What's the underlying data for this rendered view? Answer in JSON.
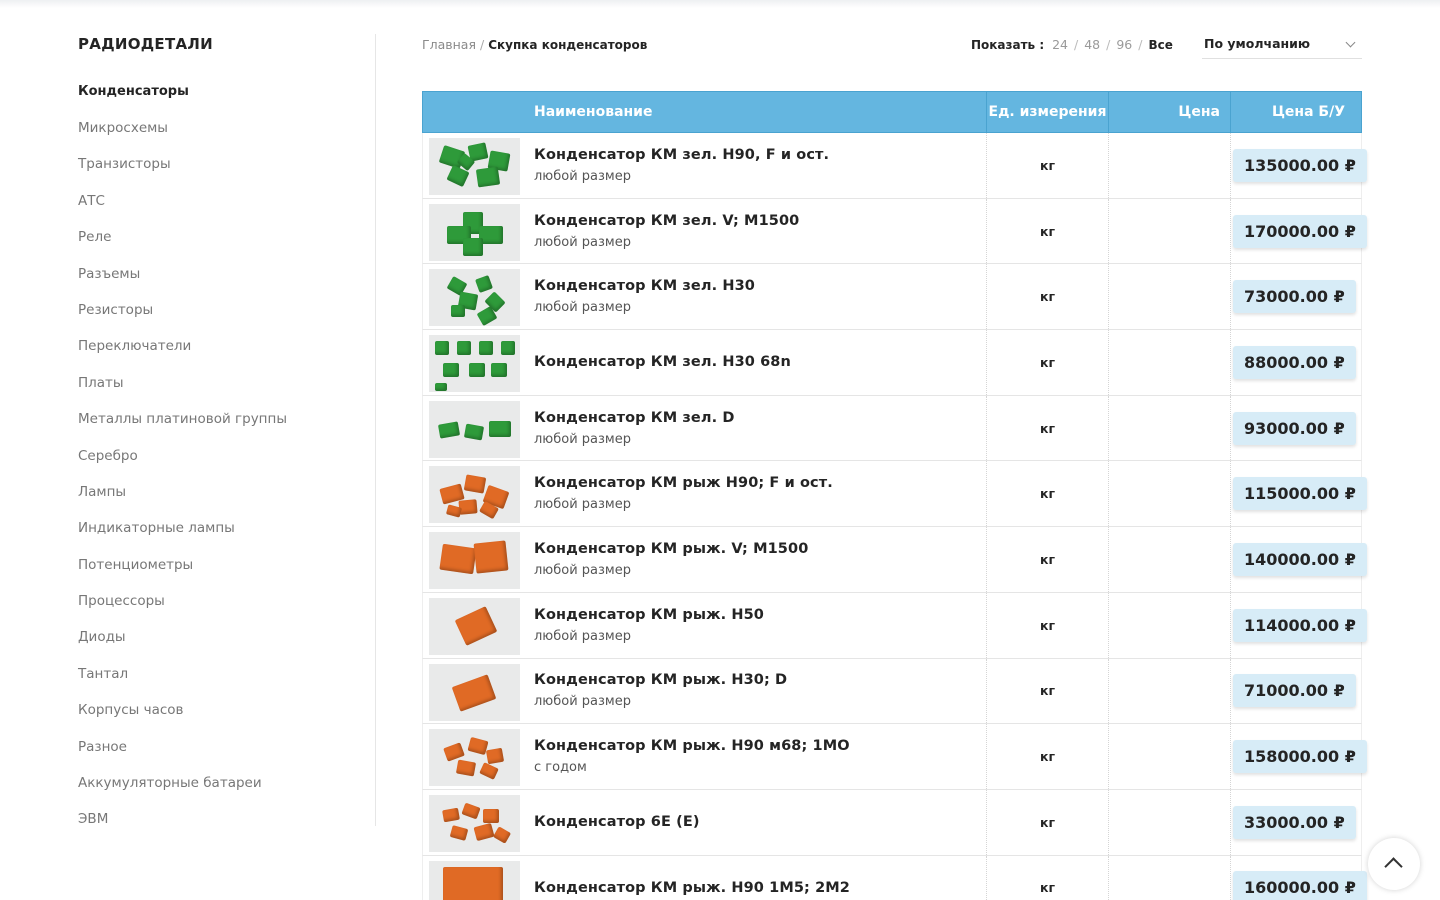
{
  "sidebar": {
    "title": "РАДИОДЕТАЛИ",
    "items": [
      {
        "label": "Конденсаторы",
        "active": true
      },
      {
        "label": "Микросхемы"
      },
      {
        "label": "Транзисторы"
      },
      {
        "label": "АТС"
      },
      {
        "label": "Реле"
      },
      {
        "label": "Разъемы"
      },
      {
        "label": "Резисторы"
      },
      {
        "label": "Переключатели"
      },
      {
        "label": "Платы"
      },
      {
        "label": "Металлы платиновой группы"
      },
      {
        "label": "Серебро"
      },
      {
        "label": "Лампы"
      },
      {
        "label": "Индикаторные лампы"
      },
      {
        "label": "Потенциометры"
      },
      {
        "label": "Процессоры"
      },
      {
        "label": "Диоды"
      },
      {
        "label": "Тантал"
      },
      {
        "label": "Корпусы часов"
      },
      {
        "label": "Разное"
      },
      {
        "label": "Аккумуляторные батареи"
      },
      {
        "label": "ЭВМ"
      }
    ]
  },
  "breadcrumb": {
    "home": "Главная",
    "separator": "/",
    "current": "Скупка конденсаторов"
  },
  "per_page": {
    "label": "Показать :",
    "options": [
      "24",
      "48",
      "96",
      "Все"
    ],
    "active": "Все",
    "separator": "/"
  },
  "sort": {
    "value": "По умолчанию"
  },
  "table": {
    "headers": {
      "name": "Наименование",
      "unit": "Ед. измерения",
      "price": "Цена",
      "used_price": "Цена Б/У"
    },
    "rows": [
      {
        "name": "Конденсатор КМ зел. Н90, F и ост.",
        "size": "любой размер",
        "unit": "кг",
        "price": "",
        "used_price": "135000.00 ₽",
        "thumb": "green"
      },
      {
        "name": "Конденсатор КМ зел. V; М1500",
        "size": "любой размер",
        "unit": "кг",
        "price": "",
        "used_price": "170000.00 ₽",
        "thumb": "green"
      },
      {
        "name": "Конденсатор КМ зел. Н30",
        "size": "любой размер",
        "unit": "кг",
        "price": "",
        "used_price": "73000.00 ₽",
        "thumb": "green"
      },
      {
        "name": "Конденсатор КМ зел. Н30 68n",
        "size": "",
        "unit": "кг",
        "price": "",
        "used_price": "88000.00 ₽",
        "thumb": "green"
      },
      {
        "name": "Конденсатор КМ зел. D",
        "size": "любой размер",
        "unit": "кг",
        "price": "",
        "used_price": "93000.00 ₽",
        "thumb": "green"
      },
      {
        "name": "Конденсатор КМ рыж Н90; F и ост.",
        "size": "любой размер",
        "unit": "кг",
        "price": "",
        "used_price": "115000.00 ₽",
        "thumb": "orange"
      },
      {
        "name": "Конденсатор КМ рыж. V; М1500",
        "size": "любой размер",
        "unit": "кг",
        "price": "",
        "used_price": "140000.00 ₽",
        "thumb": "orange"
      },
      {
        "name": "Конденсатор КМ рыж. Н50",
        "size": "любой размер",
        "unit": "кг",
        "price": "",
        "used_price": "114000.00 ₽",
        "thumb": "orange"
      },
      {
        "name": "Конденсатор КМ рыж. Н30; D",
        "size": "любой размер",
        "unit": "кг",
        "price": "",
        "used_price": "71000.00 ₽",
        "thumb": "orange"
      },
      {
        "name": "Конденсатор КМ рыж. Н90 м68; 1МО",
        "size": "с годом",
        "unit": "кг",
        "price": "",
        "used_price": "158000.00 ₽",
        "thumb": "orange"
      },
      {
        "name": "Конденсатор 6Е (Е)",
        "size": "",
        "unit": "кг",
        "price": "",
        "used_price": "33000.00 ₽",
        "thumb": "orange"
      },
      {
        "name": "Конденсатор КМ рыж. Н90 1М5; 2М2",
        "size": "",
        "unit": "кг",
        "price": "",
        "used_price": "160000.00 ₽",
        "thumb": "orange"
      }
    ]
  },
  "colors": {
    "header_bg": "#64b6e0",
    "badge_bg": "#d7ecf7",
    "green_cap": "#2e9a3a",
    "orange_cap": "#e06a25"
  },
  "icons": {
    "scroll_top": "chevron-up-icon",
    "sort": "chevron-down-icon"
  }
}
